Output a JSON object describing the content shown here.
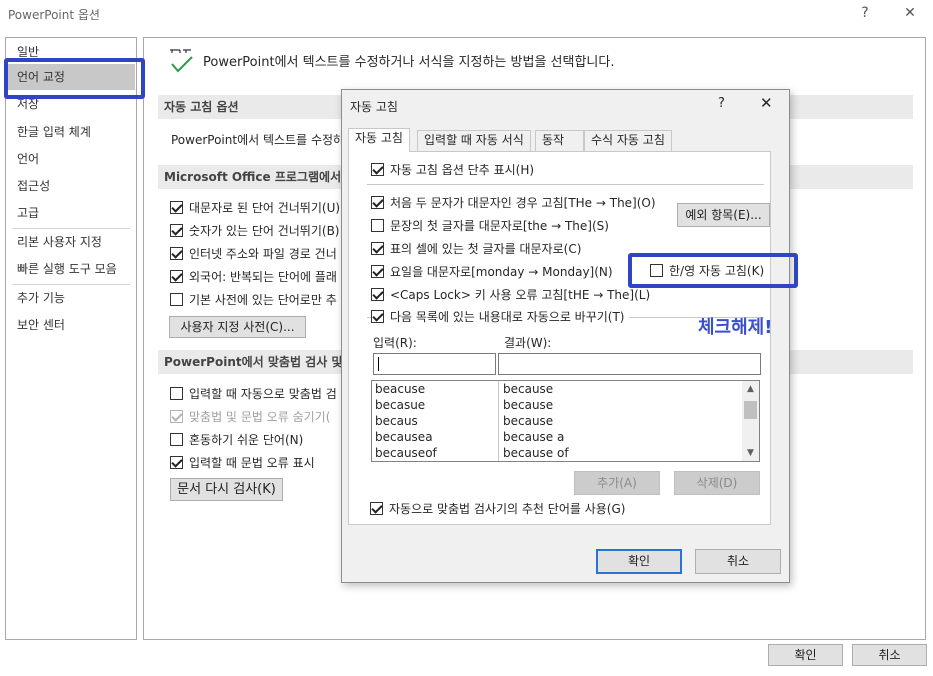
{
  "window": {
    "title": "PowerPoint 옵션",
    "help_glyph": "?",
    "close_glyph": "✕"
  },
  "nav": {
    "items": [
      {
        "label": "일반"
      },
      {
        "label": "언어 교정"
      },
      {
        "label": "저장"
      },
      {
        "label": "한글 입력 체계"
      },
      {
        "label": "언어"
      },
      {
        "label": "접근성"
      },
      {
        "label": "고급"
      },
      {
        "label": "리본 사용자 지정"
      },
      {
        "label": "빠른 실행 도구 모음"
      },
      {
        "label": "추가 기능"
      },
      {
        "label": "보안 센터"
      }
    ]
  },
  "main": {
    "header_text": "PowerPoint에서 텍스트를 수정하거나 서식을 지정하는 방법을 선택합니다.",
    "autocorrect_section": "자동 고침 옵션",
    "autocorrect_desc": "PowerPoint에서 텍스트를 수정하",
    "office_section": "Microsoft Office 프로그램에서 맞",
    "office_options": [
      {
        "label": "대문자로 된 단어 건너뛰기(U)",
        "checked": true
      },
      {
        "label": "숫자가 있는 단어 건너뛰기(B)",
        "checked": true
      },
      {
        "label": "인터넷 주소와 파일 경로 건너",
        "checked": true
      },
      {
        "label": "외국어: 반복되는 단어에 플래",
        "checked": true
      },
      {
        "label": "기본 사전에 있는 단어로만 추",
        "checked": false
      }
    ],
    "custom_dict_button": "사용자 지정 사전(C)...",
    "ppt_section": "PowerPoint에서 맞춤법 검사 및",
    "ppt_options": [
      {
        "label": "입력할 때 자동으로 맞춤법 검",
        "checked": false,
        "disabled": false
      },
      {
        "label": "맞춤법 및 문법 오류 숨기기(",
        "checked": true,
        "disabled": true
      },
      {
        "label": "혼동하기 쉬운 단어(N)",
        "checked": false,
        "disabled": false
      },
      {
        "label": "입력할 때 문법 오류 표시",
        "checked": true,
        "disabled": false
      }
    ],
    "recheck_button": "문서 다시 검사(K)"
  },
  "footer": {
    "ok": "확인",
    "cancel": "취소"
  },
  "dialog": {
    "title": "자동 고침",
    "help_glyph": "?",
    "close_glyph": "✕",
    "tabs": [
      {
        "label": "자동 고침",
        "active": true
      },
      {
        "label": "입력할 때 자동 서식",
        "active": false
      },
      {
        "label": "동작",
        "active": false
      },
      {
        "label": "수식 자동 고침",
        "active": false
      }
    ],
    "show_buttons": {
      "label": "자동 고침 옵션 단추 표시(H)",
      "checked": true
    },
    "options": [
      {
        "label": "처음 두 문자가 대문자인 경우 고침[THe → The](O)",
        "checked": true
      },
      {
        "label": "문장의 첫 글자를 대문자로[the → The](S)",
        "checked": false
      },
      {
        "label": "표의 셀에 있는 첫 글자를 대문자로(C)",
        "checked": true
      },
      {
        "label": "요일을 대문자로[monday → Monday](N)",
        "checked": true
      },
      {
        "label": "<Caps Lock> 키 사용 오류 고침[tHE → The](L)",
        "checked": true
      }
    ],
    "exceptions_button": "예외 항목(E)...",
    "hanyoung": {
      "label": "한/영 자동 고침(K)",
      "checked": false
    },
    "replace_text": {
      "label": "다음 목록에 있는 내용대로 자동으로 바꾸기(T)",
      "checked": true
    },
    "input_label": "입력(R):",
    "result_label": "결과(W):",
    "input_value": "",
    "result_value": "",
    "list": [
      {
        "from": "beacuse",
        "to": "because"
      },
      {
        "from": "becasue",
        "to": "because"
      },
      {
        "from": "becaus",
        "to": "because"
      },
      {
        "from": "becausea",
        "to": "because a"
      },
      {
        "from": "becauseof",
        "to": "because of"
      }
    ],
    "add_button": "추가(A)",
    "delete_button": "삭제(D)",
    "suggest": {
      "label": "자동으로 맞춤법 검사기의 추천 단어를 사용(G)",
      "checked": true
    },
    "ok": "확인",
    "cancel": "취소"
  },
  "annotation": {
    "text": "체크해제!",
    "color": "#3a4fcb"
  }
}
